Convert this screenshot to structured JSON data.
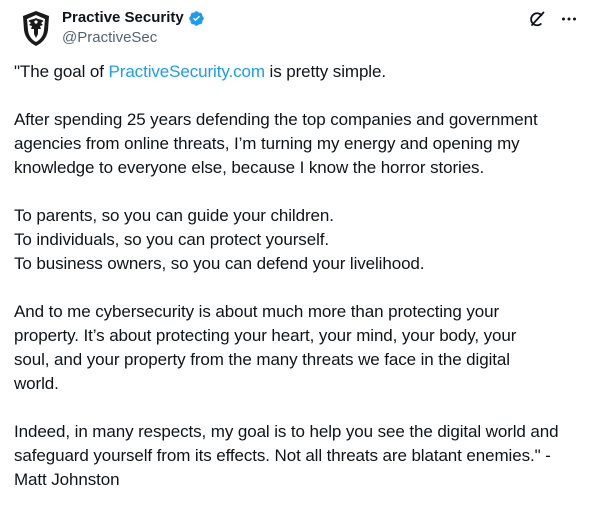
{
  "author": {
    "display_name": "Practive Security",
    "handle": "@PractiveSec",
    "avatar_icon": "eagle-shield-logo",
    "verified_icon": "verified-badge-icon",
    "verified_color": "#1d9bf0"
  },
  "actions": {
    "grok_icon": "slash-circle-icon",
    "more_icon": "more-dots-icon"
  },
  "post": {
    "p1": {
      "before": "\"The goal of ",
      "link": "PractiveSecurity.com",
      "after": " is pretty simple."
    },
    "p2": [
      "After spending 25 years defending the top companies and government",
      "agencies from online threats, I’m turning my energy and opening my",
      "knowledge to everyone else, because I know the horror stories."
    ],
    "p3": [
      "To parents, so you can guide your children.",
      "To individuals, so you can protect yourself.",
      "To business owners, so you can defend your livelihood."
    ],
    "p4": [
      "And to me cybersecurity is about much more than protecting your",
      "property. It’s about protecting your heart, your mind, your body, your",
      "soul, and your property from the many threats we face in the digital",
      "world."
    ],
    "p5": [
      "Indeed, in many respects, my goal is to help you see the digital world and",
      "safeguard yourself from its effects. Not all threats are blatant enemies.\" -",
      "Matt Johnston"
    ]
  },
  "colors": {
    "text": "#0f1419",
    "secondary": "#536471",
    "link": "#1d9bf0"
  }
}
